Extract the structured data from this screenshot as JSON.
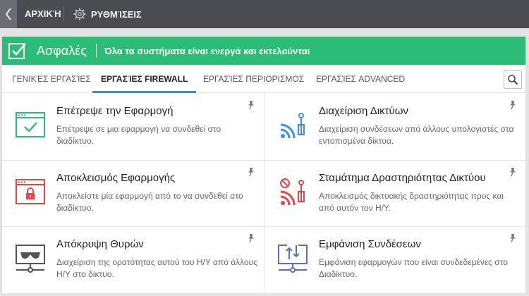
{
  "nav": {
    "home_label": "ΑΡΧΙΚΉ",
    "settings_label": "ΡΥΘΜΊΣΕΙΣ"
  },
  "status": {
    "state_label": "Ασφαλές",
    "message": "Όλα τα συστήματα είναι ενεργά και εκτελούνται",
    "color": "#2bbd78"
  },
  "tabs": [
    {
      "label": "ΓΕΝΙΚΈΣ ΕΡΓΑΣΊΕΣ",
      "active": false
    },
    {
      "label": "ΕΡΓΑΣΊΕΣ FIREWALL",
      "active": true
    },
    {
      "label": "ΕΡΓΑΣΊΕΣ ΠΕΡΙΟΡΙΣΜΟΣ",
      "active": false
    },
    {
      "label": "ΕΡΓΑΣΊΕΣ ADVANCED",
      "active": false
    }
  ],
  "cards": [
    {
      "title": "Επέτρεψε την Εφαρμογή",
      "desc": "Επέτρεψε σε μια εφαρμογή να συνδεθεί στο διαδίκτυο.",
      "icon": "allow-app-icon",
      "color": "#2bbd78"
    },
    {
      "title": "Διαχείριση Δικτύων",
      "desc": "Διαχείριση συνδέσεων από άλλους υπολογιστές στα εντοπισμένα δίκτυα.",
      "icon": "network-signal-icon",
      "color": "#3d8fe0"
    },
    {
      "title": "Αποκλεισμός Εφαρμογής",
      "desc": "Αποκλείστε μία εφαρμογή από το να συνδεθεί στο διαδίκτυο.",
      "icon": "block-app-icon",
      "color": "#e0474c"
    },
    {
      "title": "Σταμάτημα Δραστηριότητας Δικτύου",
      "desc": "Αποκλεισμός δικτυακής δραστηριότητας προς και από αυτόν τον Η/Υ.",
      "icon": "stop-network-icon",
      "color": "#e0474c"
    },
    {
      "title": "Απόκρυψη Θυρών",
      "desc": "Διαχείριση της ορατότητας αυτού του Η/Υ από άλλους Η/Υ στο δίκτυο.",
      "icon": "hide-ports-icon",
      "color": "#555555"
    },
    {
      "title": "Εμφάνιση Συνδέσεων",
      "desc": "Εμφάνιση εφαρμογών που είναι συνδεδεμένες στο Διαδίκτυο.",
      "icon": "show-connections-icon",
      "color": "#5a6fb5"
    }
  ]
}
